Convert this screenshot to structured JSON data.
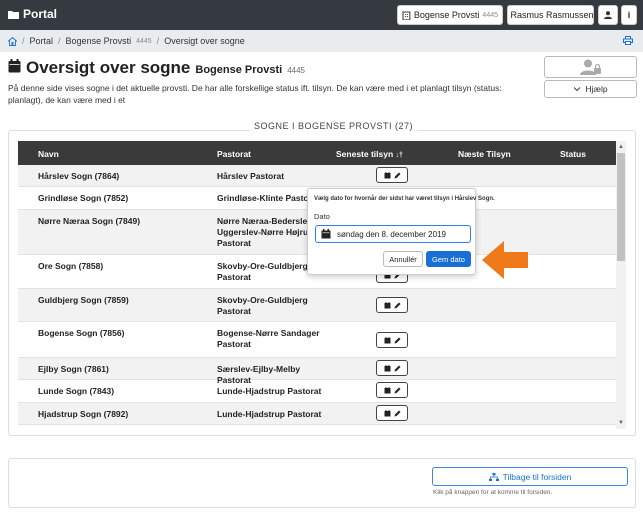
{
  "topbar": {
    "brand": "Portal",
    "provsti_button": "Bogense Provsti",
    "provsti_code": "4445",
    "user_button": "Rasmus Rasmussen",
    "info_label": "i"
  },
  "breadcrumb": {
    "items": [
      {
        "label": "Portal"
      },
      {
        "label": "Bogense Provsti",
        "sub": "4445"
      },
      {
        "label": "Oversigt over sogne"
      }
    ]
  },
  "page": {
    "title": "Oversigt over sogne",
    "subtitle": "Bogense Provsti",
    "subtitle_code": "4445",
    "intro": "På denne side vises sogne i det aktuelle provsti. De har alle forskellige status ift. tilsyn. De kan være med i et planlagt tilsyn (status: planlagt), de kan være med i et",
    "help_label": "Hjælp"
  },
  "section": {
    "title": "SOGNE I BOGENSE PROVSTI",
    "count": "(27)"
  },
  "table": {
    "headers": {
      "navn": "Navn",
      "pastorat": "Pastorat",
      "seneste": "Seneste tilsyn",
      "sort_icon": "↓†",
      "naeste": "Næste Tilsyn",
      "status": "Status"
    },
    "rows": [
      {
        "navn": "Hårslev Sogn (7864)",
        "pastorat": "Hårslev Pastorat"
      },
      {
        "navn": "Grindløse Sogn (7852)",
        "pastorat": "Grindløse-Klinte Pastorat"
      },
      {
        "navn": "Nørre Næraa Sogn (7849)",
        "pastorat": "Nørre Næraa-Bederslev-Uggerslev-Nørre Højrup Pastorat"
      },
      {
        "navn": "Ore Sogn (7858)",
        "pastorat": "Skovby-Ore-Guldbjerg Pastorat"
      },
      {
        "navn": "Guldbjerg Sogn (7859)",
        "pastorat": "Skovby-Ore-Guldbjerg Pastorat"
      },
      {
        "navn": "Bogense Sogn (7856)",
        "pastorat": "Bogense-Nørre Sandager Pastorat"
      },
      {
        "navn": "Ejlby Sogn (7861)",
        "pastorat": "Særslev-Ejlby-Melby Pastorat"
      },
      {
        "navn": "Lunde Sogn (7843)",
        "pastorat": "Lunde-Hjadstrup Pastorat"
      },
      {
        "navn": "Hjadstrup Sogn (7892)",
        "pastorat": "Lunde-Hjadstrup Pastorat"
      }
    ]
  },
  "popover": {
    "title": "Vælg dato for hvornår der sidst har været tilsyn i Hårslev Sogn.",
    "label": "Dato",
    "date_value": "søndag den 8. december 2019",
    "cancel": "Annullér",
    "save": "Gem dato"
  },
  "footer": {
    "back_button": "Tilbage til forsiden",
    "note": "Klik på knappen for at komme til forsiden."
  },
  "colors": {
    "topbar": "#343a40",
    "primary": "#1a6fd6",
    "arrow": "#f07a1a",
    "table_header": "#3a3a3a"
  }
}
